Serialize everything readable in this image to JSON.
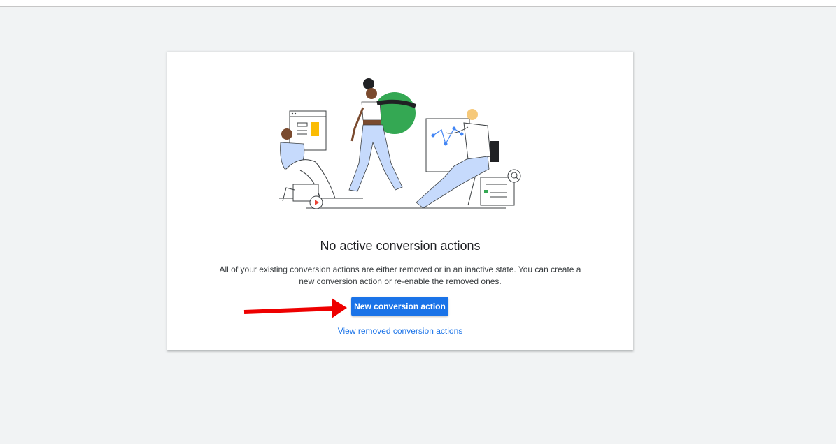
{
  "empty_state": {
    "title": "No active conversion actions",
    "description": "All of your existing conversion actions are either removed or in an inactive state. You can create a new conversion action or re-enable the removed ones.",
    "primary_button_label": "New conversion action",
    "secondary_link_label": "View removed conversion actions"
  },
  "colors": {
    "accent": "#1a73e8",
    "background": "#f1f3f4",
    "annotation_arrow": "#ee0000"
  }
}
